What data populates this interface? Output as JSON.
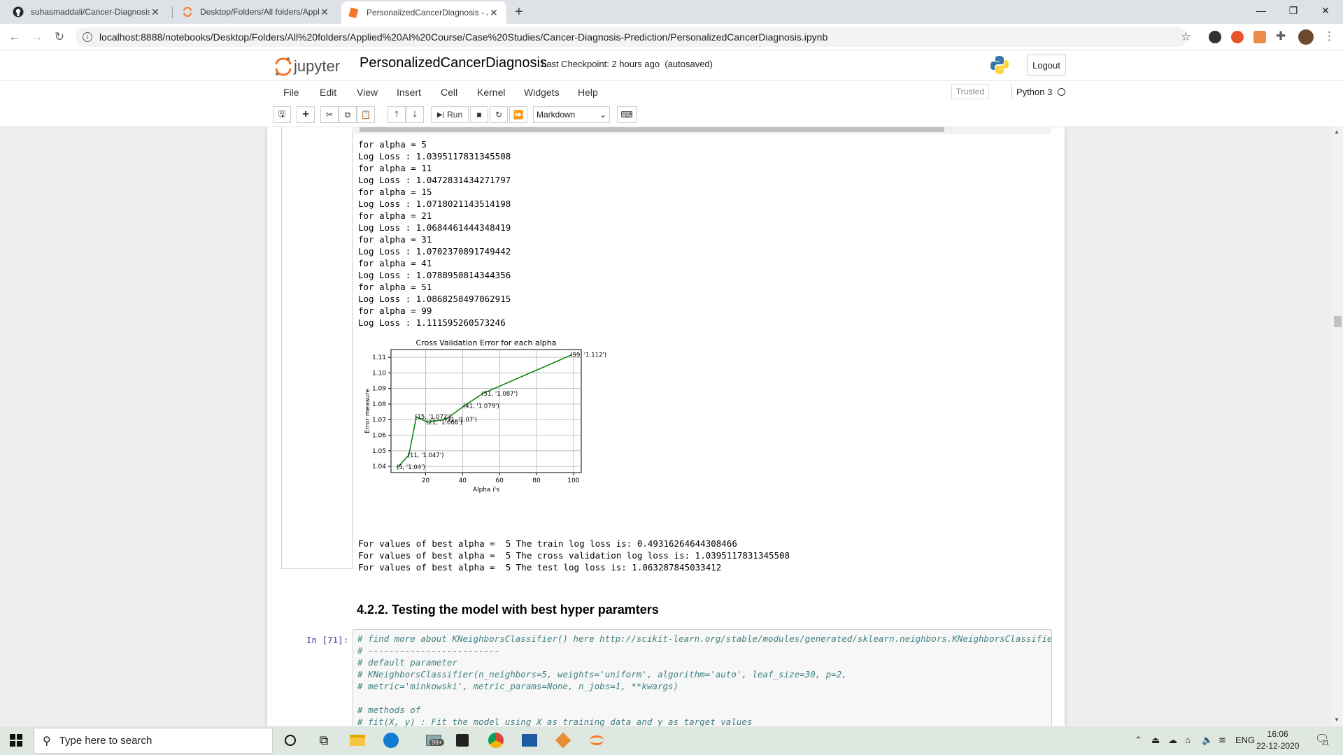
{
  "browser": {
    "tabs": [
      {
        "title": "suhasmaddali/Cancer-Diagnosis-",
        "icon": "github-icon"
      },
      {
        "title": "Desktop/Folders/All folders/Appl",
        "icon": "jupyter-spinner-icon"
      },
      {
        "title": "PersonalizedCancerDiagnosis - Ju",
        "icon": "jupyter-notebook-icon"
      }
    ],
    "url": "localhost:8888/notebooks/Desktop/Folders/All%20folders/Applied%20AI%20Course/Case%20Studies/Cancer-Diagnosis-Prediction/PersonalizedCancerDiagnosis.ipynb"
  },
  "jupyter": {
    "logo_text": "jupyter",
    "notebook_name": "PersonalizedCancerDiagnosis",
    "checkpoint": "Last Checkpoint: 2 hours ago",
    "autosave": "(autosaved)",
    "logout_label": "Logout",
    "menus": [
      "File",
      "Edit",
      "View",
      "Insert",
      "Cell",
      "Kernel",
      "Widgets",
      "Help"
    ],
    "trusted_label": "Trusted",
    "kernel_name": "Python 3",
    "run_label": "Run",
    "cell_type": "Markdown"
  },
  "output": {
    "log_lines": [
      "for alpha = 5",
      "Log Loss : 1.0395117831345508",
      "for alpha = 11",
      "Log Loss : 1.0472831434271797",
      "for alpha = 15",
      "Log Loss : 1.0718021143514198",
      "for alpha = 21",
      "Log Loss : 1.0684461444348419",
      "for alpha = 31",
      "Log Loss : 1.0702370891749442",
      "for alpha = 41",
      "Log Loss : 1.0788950814344356",
      "for alpha = 51",
      "Log Loss : 1.0868258497062915",
      "for alpha = 99",
      "Log Loss : 1.111595260573246"
    ],
    "best_lines": [
      "For values of best alpha =  5 The train log loss is: 0.49316264644308466",
      "For values of best alpha =  5 The cross validation log loss is: 1.0395117831345508",
      "For values of best alpha =  5 The test log loss is: 1.063287845033412"
    ]
  },
  "chart_data": {
    "type": "line",
    "title": "Cross Validation Error for each alpha",
    "xlabel": "Alpha i's",
    "ylabel": "Error measure",
    "x": [
      5,
      11,
      15,
      21,
      31,
      41,
      51,
      99
    ],
    "y": [
      1.0395,
      1.0473,
      1.0718,
      1.0684,
      1.0702,
      1.0789,
      1.0868,
      1.1116
    ],
    "point_labels": [
      "(5, '1.04')",
      "(11, '1.047')",
      "(15, '1.072')",
      "(21, '1.068')",
      "(31, '1.07')",
      "(41, '1.079')",
      "(51, '1.087')",
      "(99, '1.112')"
    ],
    "xticks": [
      "20",
      "40",
      "60",
      "80",
      "100"
    ],
    "yticks": [
      "1.04",
      "1.05",
      "1.06",
      "1.07",
      "1.08",
      "1.09",
      "1.10",
      "1.11"
    ],
    "xlim": [
      1.3,
      104.2
    ],
    "ylim": [
      1.036,
      1.115
    ],
    "grid": true,
    "line_color": "#008000"
  },
  "section_heading": "4.2.2. Testing the model with best hyper paramters",
  "code_cell": {
    "prompt": "In [71]:",
    "lines": [
      "# find more about KNeighborsClassifier() here http://scikit-learn.org/stable/modules/generated/sklearn.neighbors.KNeighborsClassifier.html",
      "# -------------------------",
      "# default parameter",
      "# KNeighborsClassifier(n_neighbors=5, weights='uniform', algorithm='auto', leaf_size=30, p=2,",
      "# metric='minkowski', metric_params=None, n_jobs=1, **kwargs)",
      "",
      "# methods of",
      "# fit(X, y) : Fit the model using X as training data and y as target values"
    ]
  },
  "taskbar": {
    "search_placeholder": "Type here to search",
    "mail_badge": "99+",
    "language": "ENG",
    "time": "16:06",
    "date": "22-12-2020",
    "notification_count": "21"
  }
}
